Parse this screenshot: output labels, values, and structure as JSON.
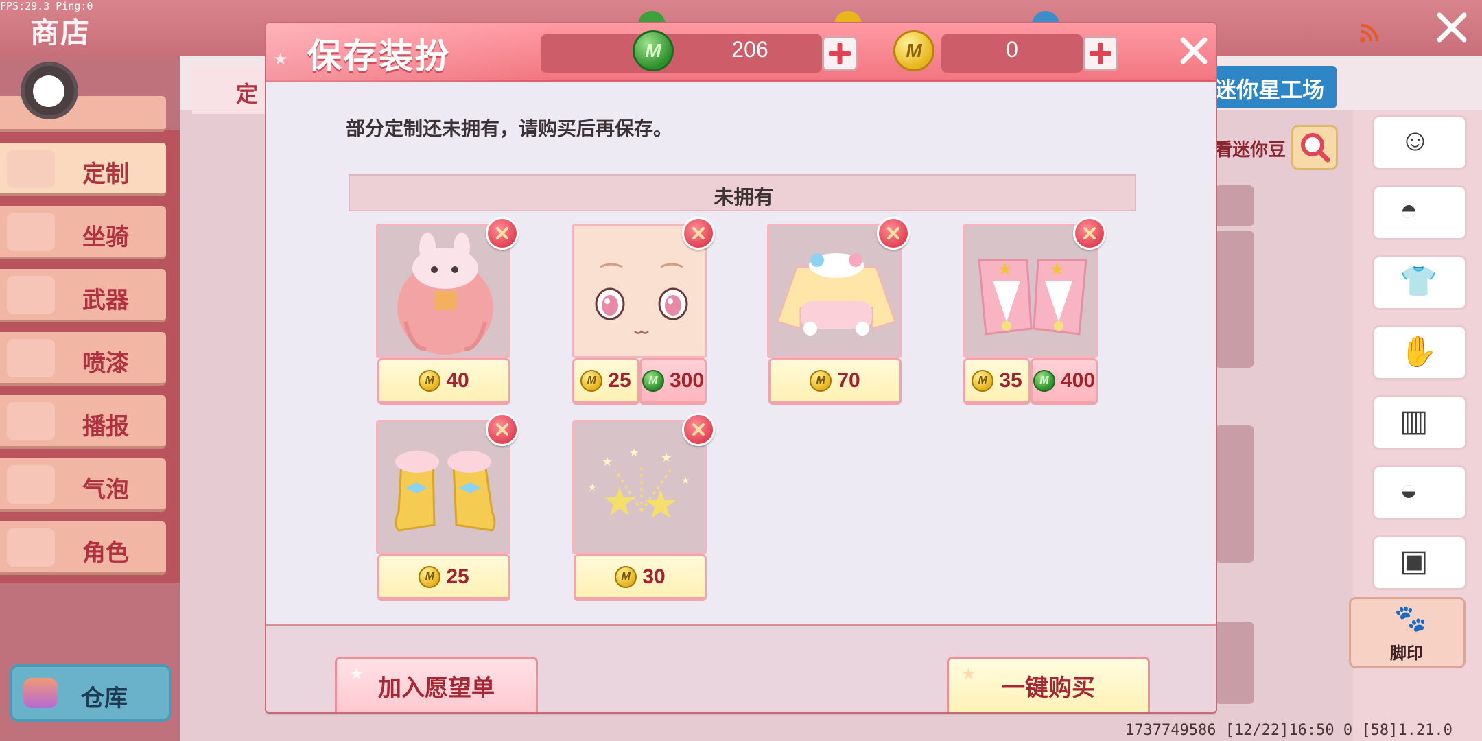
{
  "debug": {
    "fps_text": "FPS:29.3  Ping:0"
  },
  "shop": {
    "title": "商店",
    "left_tab": "定",
    "categories": [
      {
        "label": "定制",
        "selected": true
      },
      {
        "label": "坐骑"
      },
      {
        "label": "武器"
      },
      {
        "label": "喷漆"
      },
      {
        "label": "播报"
      },
      {
        "label": "气泡"
      },
      {
        "label": "角色"
      }
    ],
    "warehouse_label": "仓库",
    "studio_label": "迷你星工场",
    "view_label": "看迷你豆",
    "footprint_label": "脚印",
    "bottom_info": "1737749586   [12/22]16:50 0   [58]1.21.0",
    "side_icons": [
      "face-icon",
      "mask-icon",
      "shirt-icon",
      "glove-icon",
      "pants-icon",
      "shoes-icon",
      "backpack-icon"
    ]
  },
  "dialog": {
    "title": "保存装扮",
    "gem_balance": "206",
    "gold_balance": "0",
    "close_label": "✕",
    "message": "部分定制还未拥有，请购买后再保存。",
    "section_label": "未拥有",
    "items": [
      {
        "art": "hair-icon",
        "prices": [
          {
            "currency": "gold",
            "amount": "40"
          }
        ]
      },
      {
        "art": "face-icon",
        "prices": [
          {
            "currency": "gold",
            "amount": "25"
          },
          {
            "currency": "gem",
            "amount": "300"
          }
        ]
      },
      {
        "art": "top-icon",
        "prices": [
          {
            "currency": "gold",
            "amount": "70"
          }
        ]
      },
      {
        "art": "skirt-icon",
        "prices": [
          {
            "currency": "gold",
            "amount": "35"
          },
          {
            "currency": "gem",
            "amount": "400"
          }
        ]
      },
      {
        "art": "boots-icon",
        "prices": [
          {
            "currency": "gold",
            "amount": "25"
          }
        ]
      },
      {
        "art": "effect-icon",
        "prices": [
          {
            "currency": "gold",
            "amount": "30"
          }
        ]
      }
    ],
    "wishlist_button": "加入愿望单",
    "buy_all_button": "一键购买"
  },
  "colors": {
    "header": "#f27681",
    "price_text": "#a0232f",
    "body_bg": "#eeeaf3"
  }
}
